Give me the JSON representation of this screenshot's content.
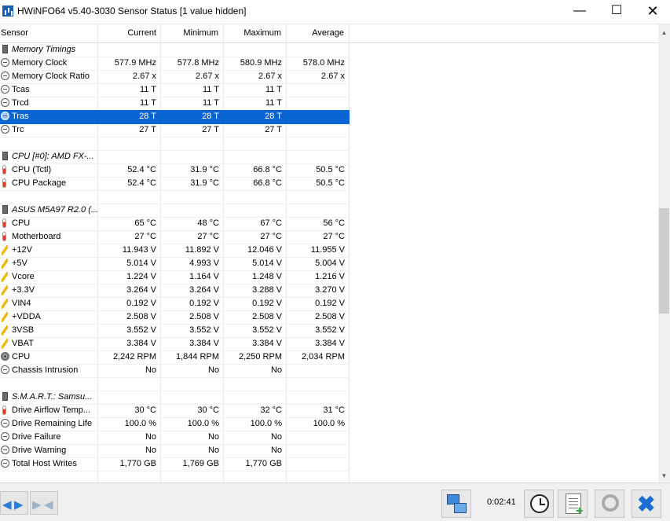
{
  "window": {
    "title": "HWiNFO64 v5.40-3030 Sensor Status [1 value hidden]",
    "minimize_glyph": "—",
    "maximize_glyph": "☐",
    "close_glyph": "✕"
  },
  "columns": [
    "Sensor",
    "Current",
    "Minimum",
    "Maximum",
    "Average"
  ],
  "rows": [
    {
      "type": "group",
      "icon": "chip-icon",
      "label": "Memory Timings",
      "v": [
        "",
        "",
        "",
        ""
      ]
    },
    {
      "type": "item",
      "icon": "clock-icon",
      "label": "Memory Clock",
      "v": [
        "577.9 MHz",
        "577.8 MHz",
        "580.9 MHz",
        "578.0 MHz"
      ]
    },
    {
      "type": "item",
      "icon": "clock-icon",
      "label": "Memory Clock Ratio",
      "v": [
        "2.67 x",
        "2.67 x",
        "2.67 x",
        "2.67 x"
      ]
    },
    {
      "type": "item",
      "icon": "clock-icon",
      "label": "Tcas",
      "v": [
        "11 T",
        "11 T",
        "11 T",
        ""
      ]
    },
    {
      "type": "item",
      "icon": "clock-icon",
      "label": "Trcd",
      "v": [
        "11 T",
        "11 T",
        "11 T",
        ""
      ]
    },
    {
      "type": "item",
      "icon": "clock-icon",
      "label": "Tras",
      "v": [
        "28 T",
        "28 T",
        "28 T",
        ""
      ],
      "selected": true
    },
    {
      "type": "item",
      "icon": "clock-icon",
      "label": "Trc",
      "v": [
        "27 T",
        "27 T",
        "27 T",
        ""
      ]
    },
    {
      "type": "blank"
    },
    {
      "type": "group",
      "icon": "chip-icon",
      "label": "CPU [#0]: AMD FX-...",
      "v": [
        "",
        "",
        "",
        ""
      ]
    },
    {
      "type": "item",
      "icon": "thermometer-icon",
      "label": "CPU (Tctl)",
      "v": [
        "52.4 °C",
        "31.9 °C",
        "66.8 °C",
        "50.5 °C"
      ]
    },
    {
      "type": "item",
      "icon": "thermometer-icon",
      "label": "CPU Package",
      "v": [
        "52.4 °C",
        "31.9 °C",
        "66.8 °C",
        "50.5 °C"
      ]
    },
    {
      "type": "blank"
    },
    {
      "type": "group",
      "icon": "chip-icon",
      "label": "ASUS M5A97 R2.0 (...",
      "v": [
        "",
        "",
        "",
        ""
      ]
    },
    {
      "type": "item",
      "icon": "thermometer-icon",
      "label": "CPU",
      "v": [
        "65 °C",
        "48 °C",
        "67 °C",
        "56 °C"
      ]
    },
    {
      "type": "item",
      "icon": "thermometer-icon",
      "label": "Motherboard",
      "v": [
        "27 °C",
        "27 °C",
        "27 °C",
        "27 °C"
      ]
    },
    {
      "type": "item",
      "icon": "voltage-icon",
      "label": "+12V",
      "v": [
        "11.943 V",
        "11.892 V",
        "12.046 V",
        "11.955 V"
      ]
    },
    {
      "type": "item",
      "icon": "voltage-icon",
      "label": "+5V",
      "v": [
        "5.014 V",
        "4.993 V",
        "5.014 V",
        "5.004 V"
      ]
    },
    {
      "type": "item",
      "icon": "voltage-icon",
      "label": "Vcore",
      "v": [
        "1.224 V",
        "1.164 V",
        "1.248 V",
        "1.216 V"
      ]
    },
    {
      "type": "item",
      "icon": "voltage-icon",
      "label": "+3.3V",
      "v": [
        "3.264 V",
        "3.264 V",
        "3.288 V",
        "3.270 V"
      ]
    },
    {
      "type": "item",
      "icon": "voltage-icon",
      "label": "VIN4",
      "v": [
        "0.192 V",
        "0.192 V",
        "0.192 V",
        "0.192 V"
      ]
    },
    {
      "type": "item",
      "icon": "voltage-icon",
      "label": "+VDDA",
      "v": [
        "2.508 V",
        "2.508 V",
        "2.508 V",
        "2.508 V"
      ]
    },
    {
      "type": "item",
      "icon": "voltage-icon",
      "label": "3VSB",
      "v": [
        "3.552 V",
        "3.552 V",
        "3.552 V",
        "3.552 V"
      ]
    },
    {
      "type": "item",
      "icon": "voltage-icon",
      "label": "VBAT",
      "v": [
        "3.384 V",
        "3.384 V",
        "3.384 V",
        "3.384 V"
      ]
    },
    {
      "type": "item",
      "icon": "fan-icon",
      "label": "CPU",
      "v": [
        "2,242 RPM",
        "1,844 RPM",
        "2,250 RPM",
        "2,034 RPM"
      ]
    },
    {
      "type": "item",
      "icon": "clock-icon",
      "label": "Chassis Intrusion",
      "v": [
        "No",
        "No",
        "No",
        ""
      ]
    },
    {
      "type": "blank"
    },
    {
      "type": "group",
      "icon": "chip-icon",
      "label": "S.M.A.R.T.: Samsu...",
      "v": [
        "",
        "",
        "",
        ""
      ]
    },
    {
      "type": "item",
      "icon": "thermometer-icon",
      "label": "Drive Airflow Temp...",
      "v": [
        "30 °C",
        "30 °C",
        "32 °C",
        "31 °C"
      ]
    },
    {
      "type": "item",
      "icon": "clock-icon",
      "label": "Drive Remaining Life",
      "v": [
        "100.0 %",
        "100.0 %",
        "100.0 %",
        "100.0 %"
      ]
    },
    {
      "type": "item",
      "icon": "clock-icon",
      "label": "Drive Failure",
      "v": [
        "No",
        "No",
        "No",
        ""
      ]
    },
    {
      "type": "item",
      "icon": "clock-icon",
      "label": "Drive Warning",
      "v": [
        "No",
        "No",
        "No",
        ""
      ]
    },
    {
      "type": "item",
      "icon": "clock-icon",
      "label": "Total Host Writes",
      "v": [
        "1,770 GB",
        "1,769 GB",
        "1,770 GB",
        ""
      ]
    }
  ],
  "bottombar": {
    "timer": "0:02:41",
    "buttons": [
      "network-icon",
      "clock-icon",
      "add-report-icon",
      "gear-icon",
      "close-x-icon"
    ]
  },
  "colors": {
    "selection": "#0a64d2",
    "accent": "#1a6fd0"
  }
}
